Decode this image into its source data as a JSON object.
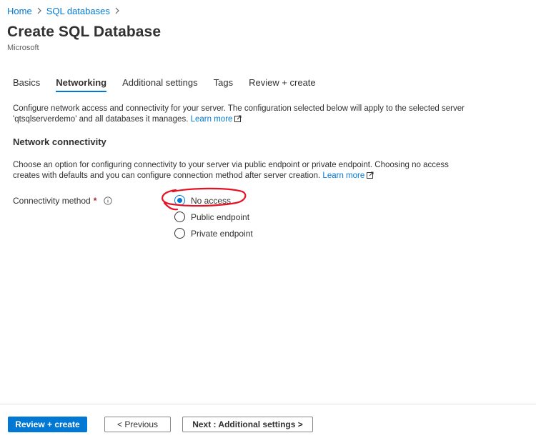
{
  "breadcrumb": {
    "home": "Home",
    "sep": ">",
    "sql_databases": "SQL databases"
  },
  "header": {
    "title": "Create SQL Database",
    "publisher": "Microsoft"
  },
  "tabs": [
    {
      "label": "Basics",
      "active": false
    },
    {
      "label": "Networking",
      "active": true
    },
    {
      "label": "Additional settings",
      "active": false
    },
    {
      "label": "Tags",
      "active": false
    },
    {
      "label": "Review + create",
      "active": false
    }
  ],
  "intro": {
    "text": "Configure network access and connectivity for your server. The configuration selected below will apply to the selected server 'qtsqlserverdemo' and all databases it manages.",
    "learn_more": "Learn more"
  },
  "network_connectivity": {
    "title": "Network connectivity",
    "text": "Choose an option for configuring connectivity to your server via public endpoint or private endpoint. Choosing no access creates with defaults and you can configure connection method after server creation.",
    "learn_more": "Learn more"
  },
  "connectivity_method": {
    "label": "Connectivity method",
    "required_mark": "*",
    "options": [
      {
        "label": "No access",
        "checked": true
      },
      {
        "label": "Public endpoint",
        "checked": false
      },
      {
        "label": "Private endpoint",
        "checked": false
      }
    ]
  },
  "footer": {
    "review_create": "Review + create",
    "previous": "< Previous",
    "next": "Next : Additional settings >"
  },
  "colors": {
    "accent": "#0078d4",
    "annotation": "#e81123",
    "required": "#a4262c"
  },
  "icons": {
    "external_link": "external-link-icon",
    "info": "info-icon"
  }
}
